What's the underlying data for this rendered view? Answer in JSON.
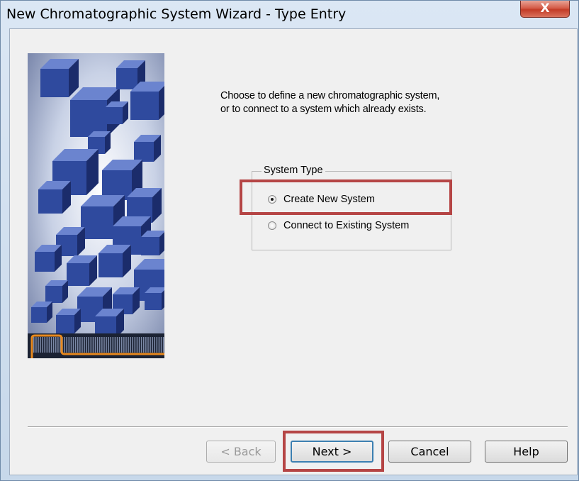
{
  "window": {
    "title": "New Chromatographic System Wizard - Type Entry",
    "close_glyph": "X"
  },
  "intro": {
    "line1": "Choose to define a new chromatographic system,",
    "line2": "or to connect to a system which already exists."
  },
  "system_type": {
    "label": "System Type",
    "options": [
      {
        "label": "Create New System",
        "checked": true
      },
      {
        "label": "Connect to Existing System",
        "checked": false
      }
    ]
  },
  "buttons": {
    "back": "< Back",
    "next": "Next >",
    "cancel": "Cancel",
    "help": "Help"
  },
  "colors": {
    "cube_blue": "#2f4a9e",
    "highlight_red": "#b54545",
    "orange_accent": "#e8891e"
  },
  "icons": {
    "wizard_image": "blue-cubes-image"
  }
}
